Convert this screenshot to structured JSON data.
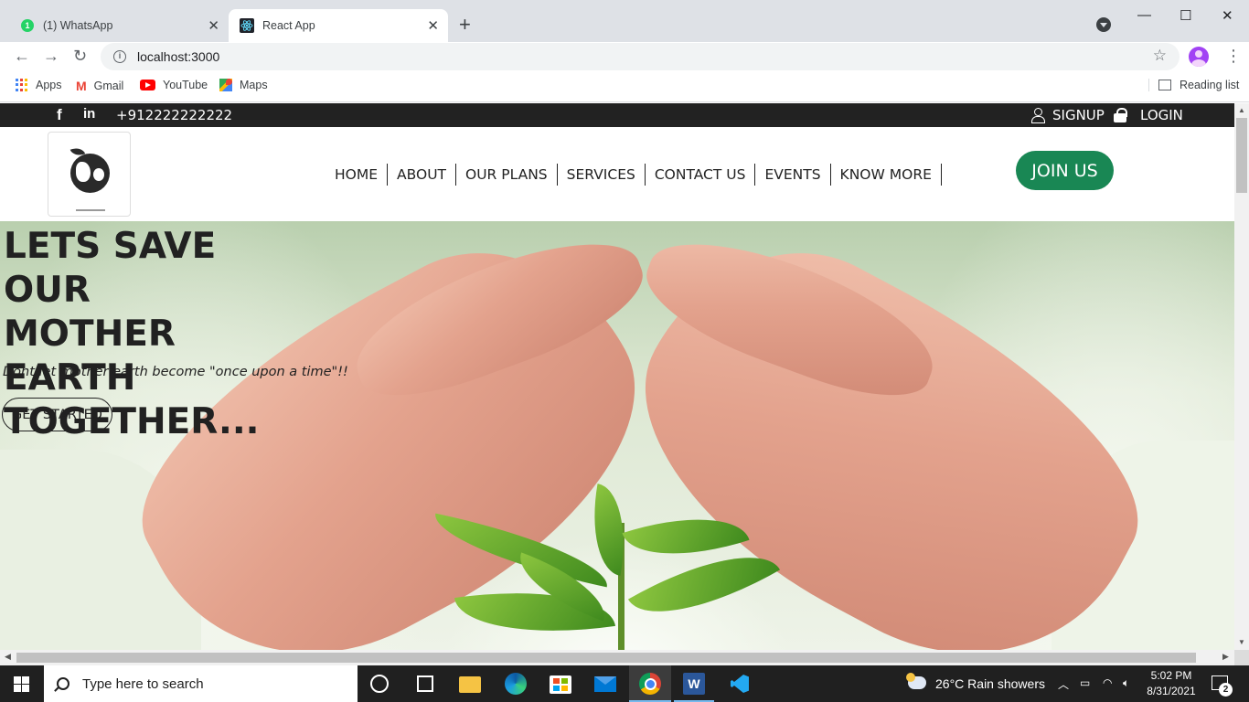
{
  "browser": {
    "tabs": [
      {
        "title": "(1) WhatsApp",
        "favicon_badge": "1",
        "active": false
      },
      {
        "title": "React App",
        "active": true
      }
    ],
    "new_tab": "+",
    "url": "localhost:3000",
    "bookmarks": [
      "Apps",
      "Gmail",
      "YouTube",
      "Maps"
    ],
    "reading_list": "Reading list"
  },
  "site": {
    "topbar": {
      "facebook": "f",
      "linkedin": "in",
      "phone": "+912222222222",
      "signup": "SIGNUP",
      "login": "LOGIN"
    },
    "nav": {
      "items": [
        "HOME",
        "ABOUT",
        "OUR PLANS",
        "SERVICES",
        "CONTACT US",
        "EVENTS",
        "KNOW MORE"
      ],
      "join": "JOIN US"
    },
    "hero": {
      "title": " LETS SAVE OUR\nMOTHER EARTH\nTOGETHER...",
      "subtitle": "Dont let mother earth become \"once upon a time\"!!",
      "cta": "GET STARTED"
    }
  },
  "taskbar": {
    "search_placeholder": "Type here to search",
    "weather": "26°C  Rain showers",
    "time": "5:02 PM",
    "date": "8/31/2021",
    "notifications": "2",
    "word_letter": "W"
  },
  "colors": {
    "join_button": "#198754",
    "topbar": "#222222",
    "taskbar": "#202020"
  }
}
